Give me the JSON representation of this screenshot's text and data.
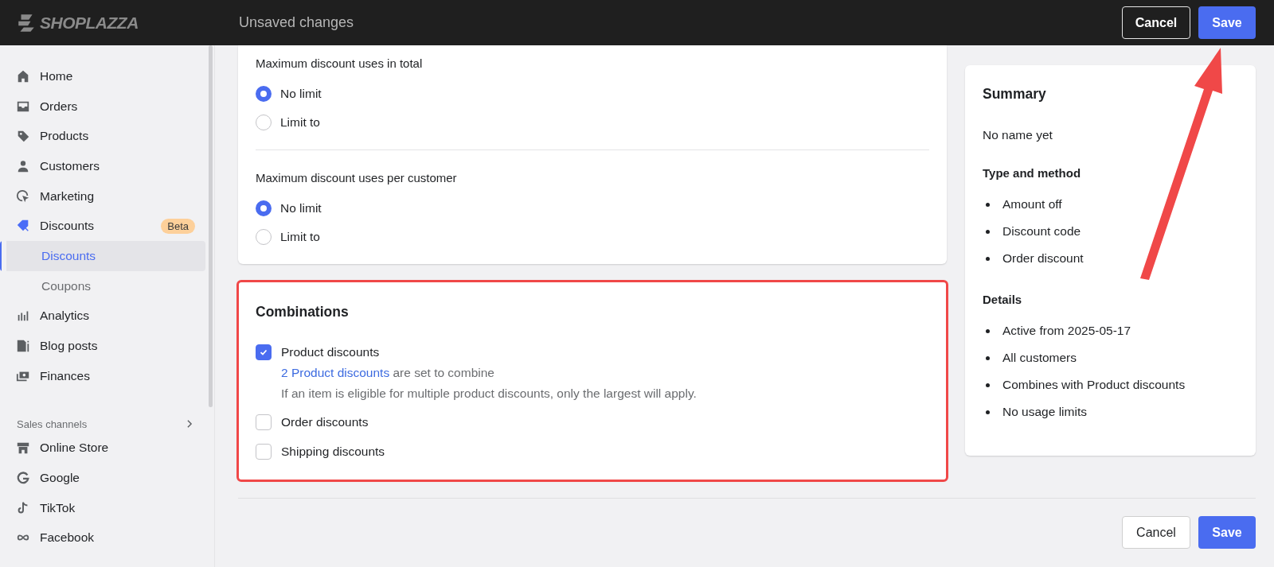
{
  "top_bar": {
    "logo": "SHOPLAZZA",
    "title": "Unsaved changes",
    "cancel": "Cancel",
    "save": "Save",
    "save_arrow": true
  },
  "sidebar": {
    "items": [
      {
        "label": "Home",
        "selected": false
      },
      {
        "label": "Orders",
        "selected": false
      },
      {
        "label": "Products",
        "selected": false
      },
      {
        "label": "Customers",
        "selected": false
      },
      {
        "label": "Marketing",
        "selected": false
      },
      {
        "label": "Discounts",
        "selected": true,
        "badge": "Beta",
        "children": [
          {
            "label": "Discounts",
            "selected": true
          },
          {
            "label": "Coupons",
            "selected": false
          }
        ]
      },
      {
        "label": "Analytics",
        "selected": false
      },
      {
        "label": "Blog posts",
        "selected": false
      },
      {
        "label": "Finances",
        "selected": false
      }
    ],
    "section": {
      "title": "Sales channels",
      "items": [
        {
          "label": "Online Store",
          "selected": false
        },
        {
          "label": "Google",
          "selected": false
        },
        {
          "label": "TikTok",
          "selected": false
        },
        {
          "label": "Facebook",
          "selected": false
        }
      ]
    }
  },
  "usage_limits": [
    {
      "label": "Maximum discount uses in total",
      "options": [
        {
          "label": "No limit",
          "selected": true
        },
        {
          "label": "Limit to",
          "selected": false
        }
      ]
    },
    {
      "label": "Maximum discount uses per customer",
      "options": [
        {
          "label": "No limit",
          "selected": true
        },
        {
          "label": "Limit to",
          "selected": false
        }
      ]
    }
  ],
  "combinations": {
    "title": "Combinations",
    "highlighted": true,
    "options": [
      {
        "label": "Product discounts",
        "checked": true,
        "link": "2 Product discounts",
        "link_suffix": " are set to combine",
        "help": "If an item is eligible for multiple product discounts, only the largest will apply."
      },
      {
        "label": "Order discounts",
        "checked": false
      },
      {
        "label": "Shipping discounts",
        "checked": false
      }
    ]
  },
  "summary": {
    "title": "Summary",
    "name": "No name yet",
    "sections": [
      {
        "heading": "Type and method",
        "items": [
          "Amount off",
          "Discount code",
          "Order discount"
        ]
      },
      {
        "heading": "Details",
        "items": [
          "Active from 2025-05-17",
          "All customers",
          "Combines with Product discounts",
          "No usage limits"
        ]
      }
    ]
  },
  "footer": {
    "cancel": "Cancel",
    "save": "Save"
  }
}
